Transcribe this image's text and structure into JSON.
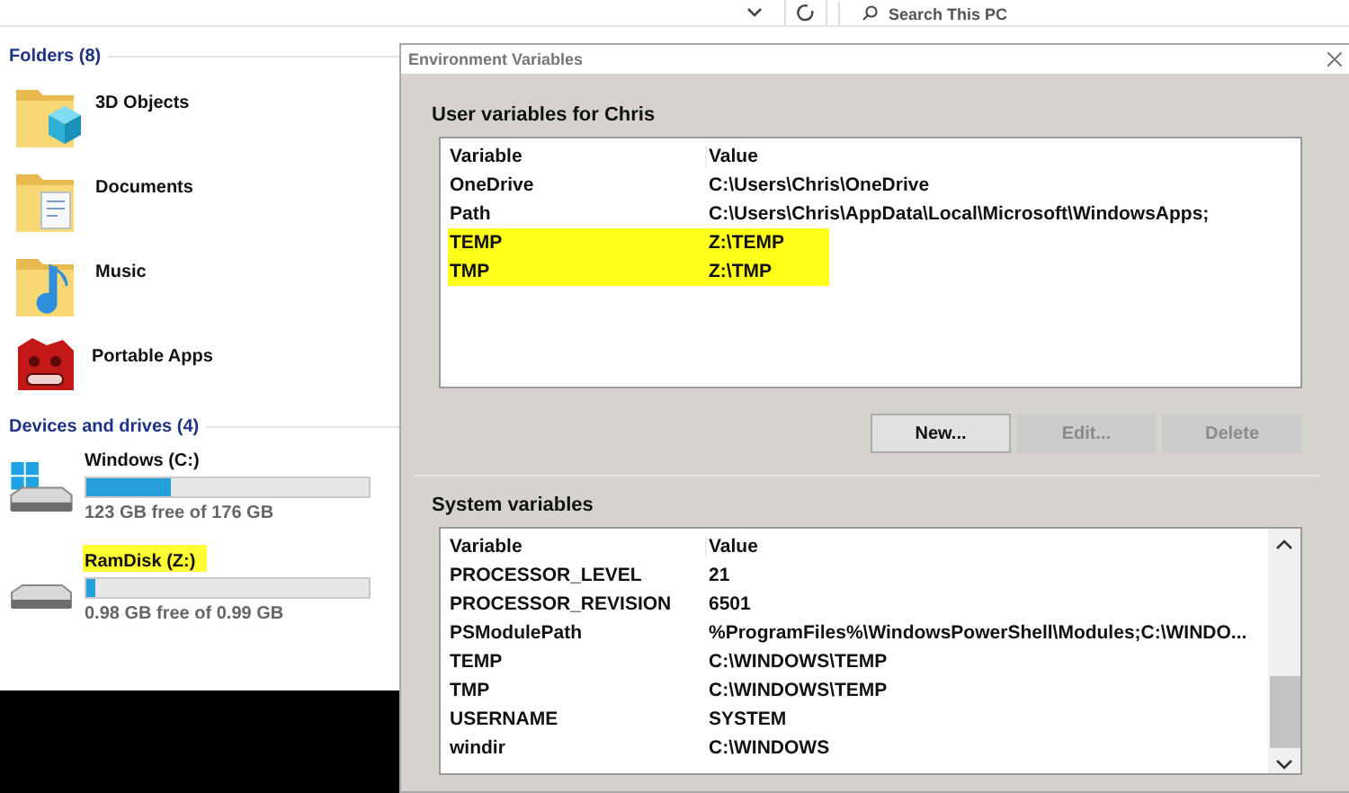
{
  "toolbar": {
    "search": {
      "placeholder": "Search This PC"
    }
  },
  "explorer": {
    "folders_header": "Folders (8)",
    "folders": [
      {
        "name": "3D Objects",
        "kind": "cube"
      },
      {
        "name": "Documents",
        "kind": "documents"
      },
      {
        "name": "Music",
        "kind": "music"
      },
      {
        "name": "Portable Apps",
        "kind": "app"
      }
    ],
    "devices_header": "Devices and drives (4)",
    "drives": [
      {
        "name": "Windows (C:)",
        "kind": "system",
        "level": 0.3,
        "reading": "123 GB free of 176 GB",
        "highlighted": false
      },
      {
        "name": "RamDisk (Z:)",
        "kind": "disk",
        "level": 0.03,
        "reading": "0.98 GB free of 0.99 GB",
        "highlighted": true
      }
    ]
  },
  "dialog": {
    "title": "Environment Variables",
    "user_section": {
      "label": "User variables for Chris",
      "columns": [
        "Variable",
        "Value"
      ],
      "rows": [
        {
          "variable": "OneDrive",
          "value": "C:\\Users\\Chris\\OneDrive",
          "highlighted": false
        },
        {
          "variable": "Path",
          "value": "C:\\Users\\Chris\\AppData\\Local\\Microsoft\\WindowsApps;",
          "highlighted": false
        },
        {
          "variable": "TEMP",
          "value": "Z:\\TEMP",
          "highlighted": true
        },
        {
          "variable": "TMP",
          "value": "Z:\\TMP",
          "highlighted": true
        }
      ]
    },
    "buttons": [
      {
        "label": "New...",
        "disabled": false
      },
      {
        "label": "Edit...",
        "disabled": true
      },
      {
        "label": "Delete",
        "disabled": true
      }
    ],
    "system_section": {
      "label": "System variables",
      "columns": [
        "Variable",
        "Value"
      ],
      "rows": [
        {
          "variable": "PROCESSOR_LEVEL",
          "value": "21",
          "highlighted": false
        },
        {
          "variable": "PROCESSOR_REVISION",
          "value": "6501",
          "highlighted": false
        },
        {
          "variable": "PSModulePath",
          "value": "%ProgramFiles%\\WindowsPowerShell\\Modules;C:\\WINDO...",
          "highlighted": false
        },
        {
          "variable": "TEMP",
          "value": "C:\\WINDOWS\\TEMP",
          "highlighted": false
        },
        {
          "variable": "TMP",
          "value": "C:\\WINDOWS\\TEMP",
          "highlighted": false
        },
        {
          "variable": "USERNAME",
          "value": "SYSTEM",
          "highlighted": false
        },
        {
          "variable": "windir",
          "value": "C:\\WINDOWS",
          "highlighted": false
        }
      ]
    }
  }
}
